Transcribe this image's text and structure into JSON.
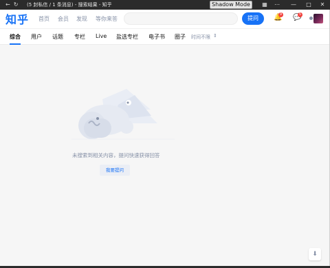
{
  "window": {
    "title": "(5 封私信 / 1 条消息) - 搜索结果 - 知乎",
    "shadow_mode": "Shadow Mode"
  },
  "header": {
    "logo": "知乎",
    "nav": [
      "首页",
      "会员",
      "发现",
      "等你来答"
    ],
    "search_placeholder": "",
    "ask_button": "提问",
    "notif_count": "9",
    "msg_count": "5"
  },
  "tabs": {
    "items": [
      "综合",
      "用户",
      "话题",
      "专栏",
      "Live",
      "盐选专栏",
      "电子书",
      "圈子"
    ],
    "active": "综合",
    "time_filter": "时间不限"
  },
  "empty": {
    "message": "未搜索到相关内容，提问快速获得回答",
    "ask_label": "我要提问"
  },
  "colors": {
    "brand": "#1772f6",
    "badge": "#f1403c",
    "muted": "#8590a6"
  },
  "icons": {
    "back": "back-arrow-icon",
    "refresh": "refresh-icon",
    "bell": "bell-icon",
    "message": "message-icon",
    "scroll_top": "arrow-down-icon"
  }
}
